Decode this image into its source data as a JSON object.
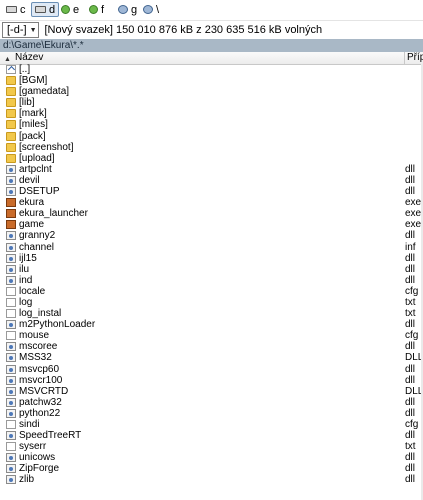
{
  "drives": [
    {
      "label": "c",
      "icon": "drive-icon",
      "active": false
    },
    {
      "label": "d",
      "icon": "drive-icon",
      "active": true
    },
    {
      "label": "e",
      "icon": "cd-drive-icon",
      "active": false
    },
    {
      "label": "f",
      "icon": "cd-drive-icon",
      "active": false
    },
    {
      "label": "g",
      "icon": "network-drive-icon",
      "active": false
    },
    {
      "label": "\\",
      "icon": "network-root-icon",
      "active": false
    }
  ],
  "infobar": {
    "drive_select": "[-d-]",
    "volume_text": "[Nový svazek]  150 010 876 kB z 230 635 516 kB volných"
  },
  "path": "d:\\Game\\Ekura\\*.*",
  "columns": {
    "name": "Název",
    "ext": "Příp"
  },
  "files": [
    {
      "name": "[..]",
      "ext": "",
      "type": "up"
    },
    {
      "name": "[BGM]",
      "ext": "",
      "type": "folder"
    },
    {
      "name": "[gamedata]",
      "ext": "",
      "type": "folder"
    },
    {
      "name": "[lib]",
      "ext": "",
      "type": "folder"
    },
    {
      "name": "[mark]",
      "ext": "",
      "type": "folder"
    },
    {
      "name": "[miles]",
      "ext": "",
      "type": "folder"
    },
    {
      "name": "[pack]",
      "ext": "",
      "type": "folder"
    },
    {
      "name": "[screenshot]",
      "ext": "",
      "type": "folder"
    },
    {
      "name": "[upload]",
      "ext": "",
      "type": "folder"
    },
    {
      "name": "artpclnt",
      "ext": "dll",
      "type": "dll"
    },
    {
      "name": "devil",
      "ext": "dll",
      "type": "dll"
    },
    {
      "name": "DSETUP",
      "ext": "dll",
      "type": "dll"
    },
    {
      "name": "ekura",
      "ext": "exe",
      "type": "exe"
    },
    {
      "name": "ekura_launcher",
      "ext": "exe",
      "type": "exe"
    },
    {
      "name": "game",
      "ext": "exe",
      "type": "exe"
    },
    {
      "name": "granny2",
      "ext": "dll",
      "type": "dll"
    },
    {
      "name": "channel",
      "ext": "inf",
      "type": "dll"
    },
    {
      "name": "ijl15",
      "ext": "dll",
      "type": "dll"
    },
    {
      "name": "ilu",
      "ext": "dll",
      "type": "dll"
    },
    {
      "name": "ind",
      "ext": "dll",
      "type": "dll"
    },
    {
      "name": "locale",
      "ext": "cfg",
      "type": "doc"
    },
    {
      "name": "log",
      "ext": "txt",
      "type": "doc"
    },
    {
      "name": "log_instal",
      "ext": "txt",
      "type": "doc"
    },
    {
      "name": "m2PythonLoader",
      "ext": "dll",
      "type": "dll"
    },
    {
      "name": "mouse",
      "ext": "cfg",
      "type": "doc"
    },
    {
      "name": "mscoree",
      "ext": "dll",
      "type": "dll"
    },
    {
      "name": "MSS32",
      "ext": "DLL",
      "type": "dll"
    },
    {
      "name": "msvcp60",
      "ext": "dll",
      "type": "dll"
    },
    {
      "name": "msvcr100",
      "ext": "dll",
      "type": "dll"
    },
    {
      "name": "MSVCRTD",
      "ext": "DLL",
      "type": "dll"
    },
    {
      "name": "patchw32",
      "ext": "dll",
      "type": "dll"
    },
    {
      "name": "python22",
      "ext": "dll",
      "type": "dll"
    },
    {
      "name": "sindi",
      "ext": "cfg",
      "type": "doc"
    },
    {
      "name": "SpeedTreeRT",
      "ext": "dll",
      "type": "dll"
    },
    {
      "name": "syserr",
      "ext": "txt",
      "type": "doc"
    },
    {
      "name": "unicows",
      "ext": "dll",
      "type": "dll"
    },
    {
      "name": "ZipForge",
      "ext": "dll",
      "type": "dll"
    },
    {
      "name": "zlib",
      "ext": "dll",
      "type": "dll"
    }
  ]
}
